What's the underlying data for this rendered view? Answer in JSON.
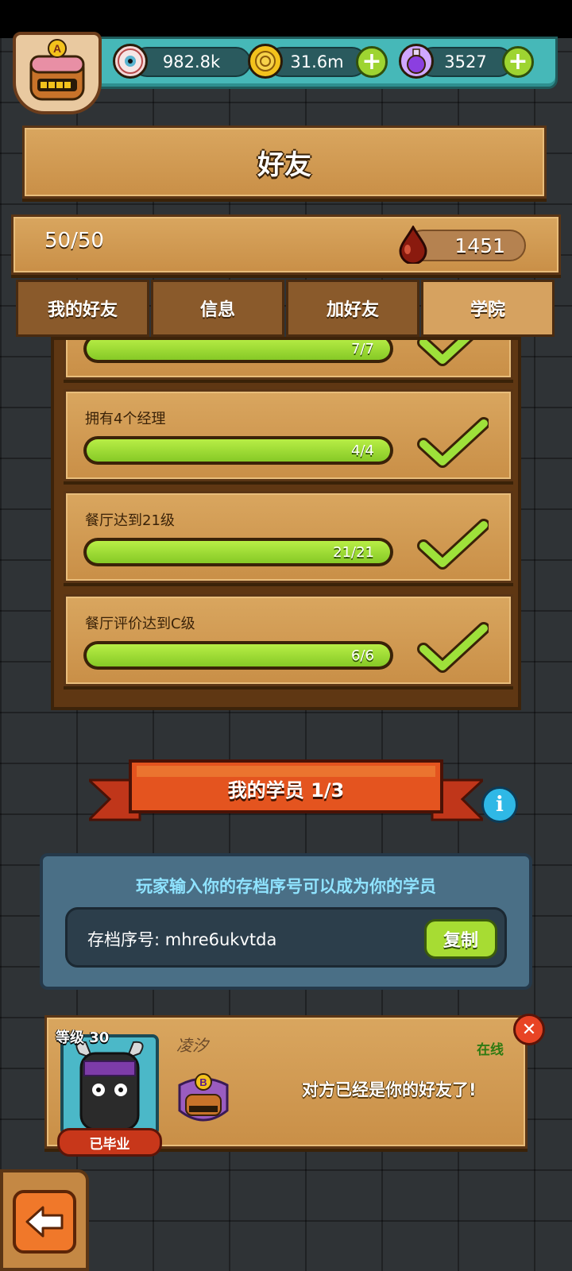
{
  "resources": {
    "eyeballs": "982.8k",
    "coins": "31.6m",
    "potions": "3527"
  },
  "player": {
    "rank_letter": "A"
  },
  "title": "好友",
  "stats": {
    "friend_count": "50/50",
    "blood_drops": "1451"
  },
  "tabs": [
    {
      "label": "我的好友",
      "active": false
    },
    {
      "label": "信息",
      "active": false
    },
    {
      "label": "加好友",
      "active": false
    },
    {
      "label": "学院",
      "active": true
    }
  ],
  "tasks": [
    {
      "label": "",
      "progress_text": "7/7",
      "fraction": 1.0
    },
    {
      "label": "拥有4个经理",
      "progress_text": "4/4",
      "fraction": 1.0
    },
    {
      "label": "餐厅达到21级",
      "progress_text": "21/21",
      "fraction": 1.0
    },
    {
      "label": "餐厅评价达到C级",
      "progress_text": "6/6",
      "fraction": 1.0
    }
  ],
  "students_section": {
    "title": "我的学员",
    "count": "1/3"
  },
  "save_code": {
    "caption": "玩家输入你的存档序号可以成为你的学员",
    "label": "存档序号:",
    "value": "mhre6ukvtda",
    "copy_label": "复制"
  },
  "student": {
    "level_label": "等级 30",
    "name": "凌汐",
    "status": "在线",
    "graduated_label": "已毕业",
    "rank_letter": "B",
    "note": "对方已经是你的好友了!"
  },
  "colors": {
    "progress_green": "#9ee13a",
    "tab_active": "#d6a260",
    "accent_teal": "#46b8b8"
  }
}
